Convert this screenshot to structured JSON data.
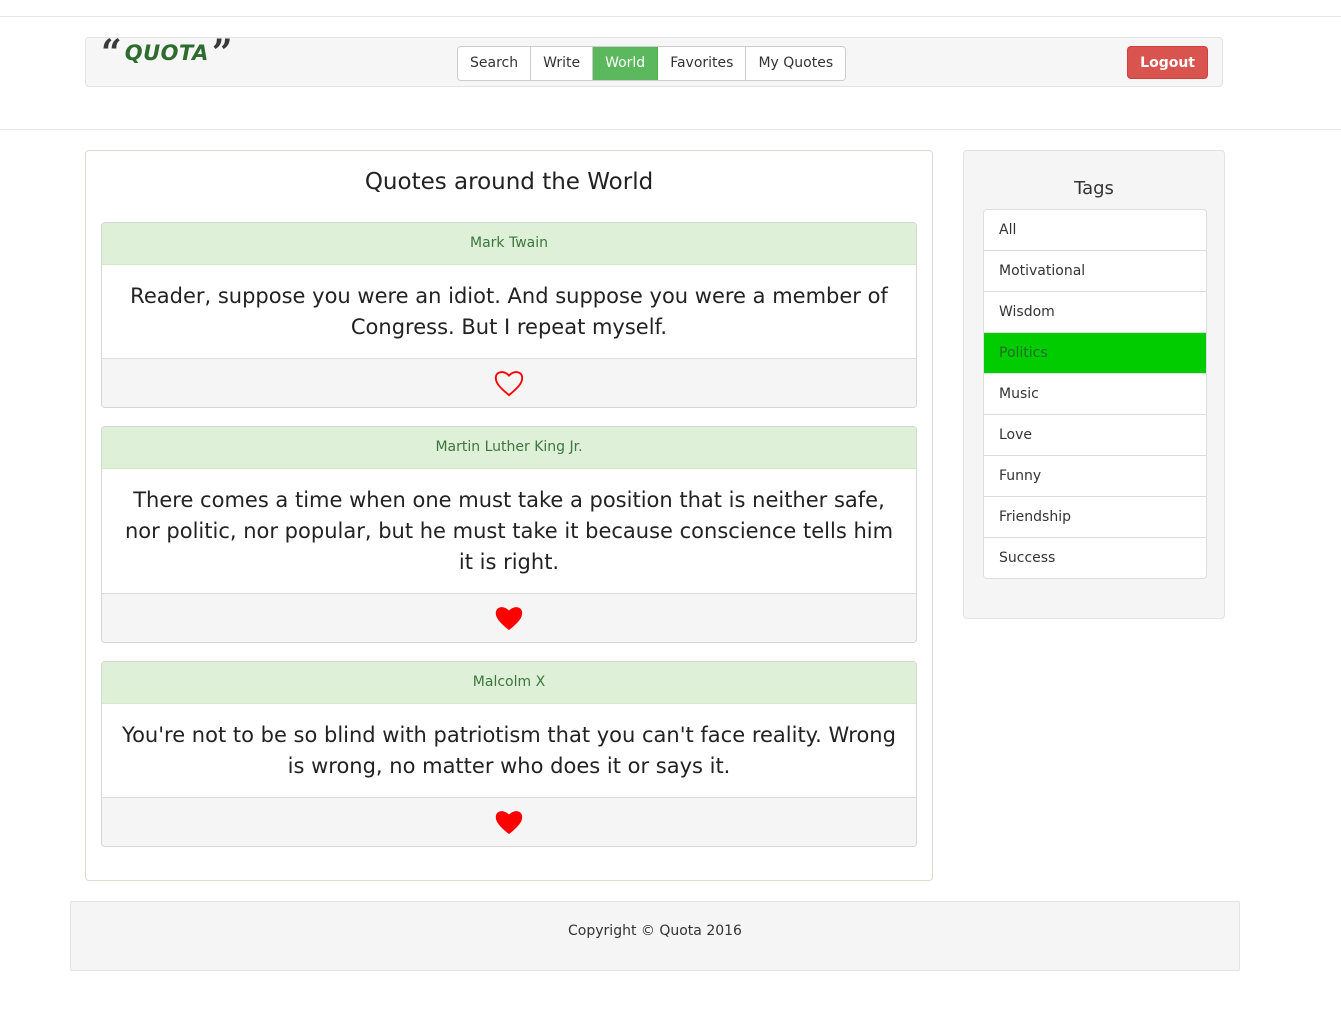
{
  "brand": {
    "name": "QUOTA",
    "open_quote": "“",
    "close_quote": "”"
  },
  "nav": {
    "items": [
      {
        "label": "Search",
        "active": false
      },
      {
        "label": "Write",
        "active": false
      },
      {
        "label": "World",
        "active": true
      },
      {
        "label": "Favorites",
        "active": false
      },
      {
        "label": "My Quotes",
        "active": false
      }
    ],
    "logout_label": "Logout"
  },
  "main": {
    "title": "Quotes around the World",
    "quotes": [
      {
        "author": "Mark Twain",
        "text": "Reader, suppose you were an idiot. And suppose you were a member of Congress. But I repeat myself.",
        "favorited": false
      },
      {
        "author": "Martin Luther King Jr.",
        "text": "There comes a time when one must take a position that is neither safe, nor politic, nor popular, but he must take it because conscience tells him it is right.",
        "favorited": true
      },
      {
        "author": "Malcolm X",
        "text": "You're not to be so blind with patriotism that you can't face reality. Wrong is wrong, no matter who does it or says it.",
        "favorited": true
      }
    ]
  },
  "sidebar": {
    "title": "Tags",
    "tags": [
      {
        "label": "All",
        "active": false
      },
      {
        "label": "Motivational",
        "active": false
      },
      {
        "label": "Wisdom",
        "active": false
      },
      {
        "label": "Politics",
        "active": true
      },
      {
        "label": "Music",
        "active": false
      },
      {
        "label": "Love",
        "active": false
      },
      {
        "label": "Funny",
        "active": false
      },
      {
        "label": "Friendship",
        "active": false
      },
      {
        "label": "Success",
        "active": false
      }
    ]
  },
  "footer": {
    "copyright": "Copyright © Quota 2016"
  },
  "colors": {
    "active_nav": "#5cb85c",
    "logout": "#d9534f",
    "quote_header_bg": "#dff0d8",
    "quote_header_text": "#3c763d",
    "active_tag": "#00cc00",
    "heart": "#ff0000"
  }
}
